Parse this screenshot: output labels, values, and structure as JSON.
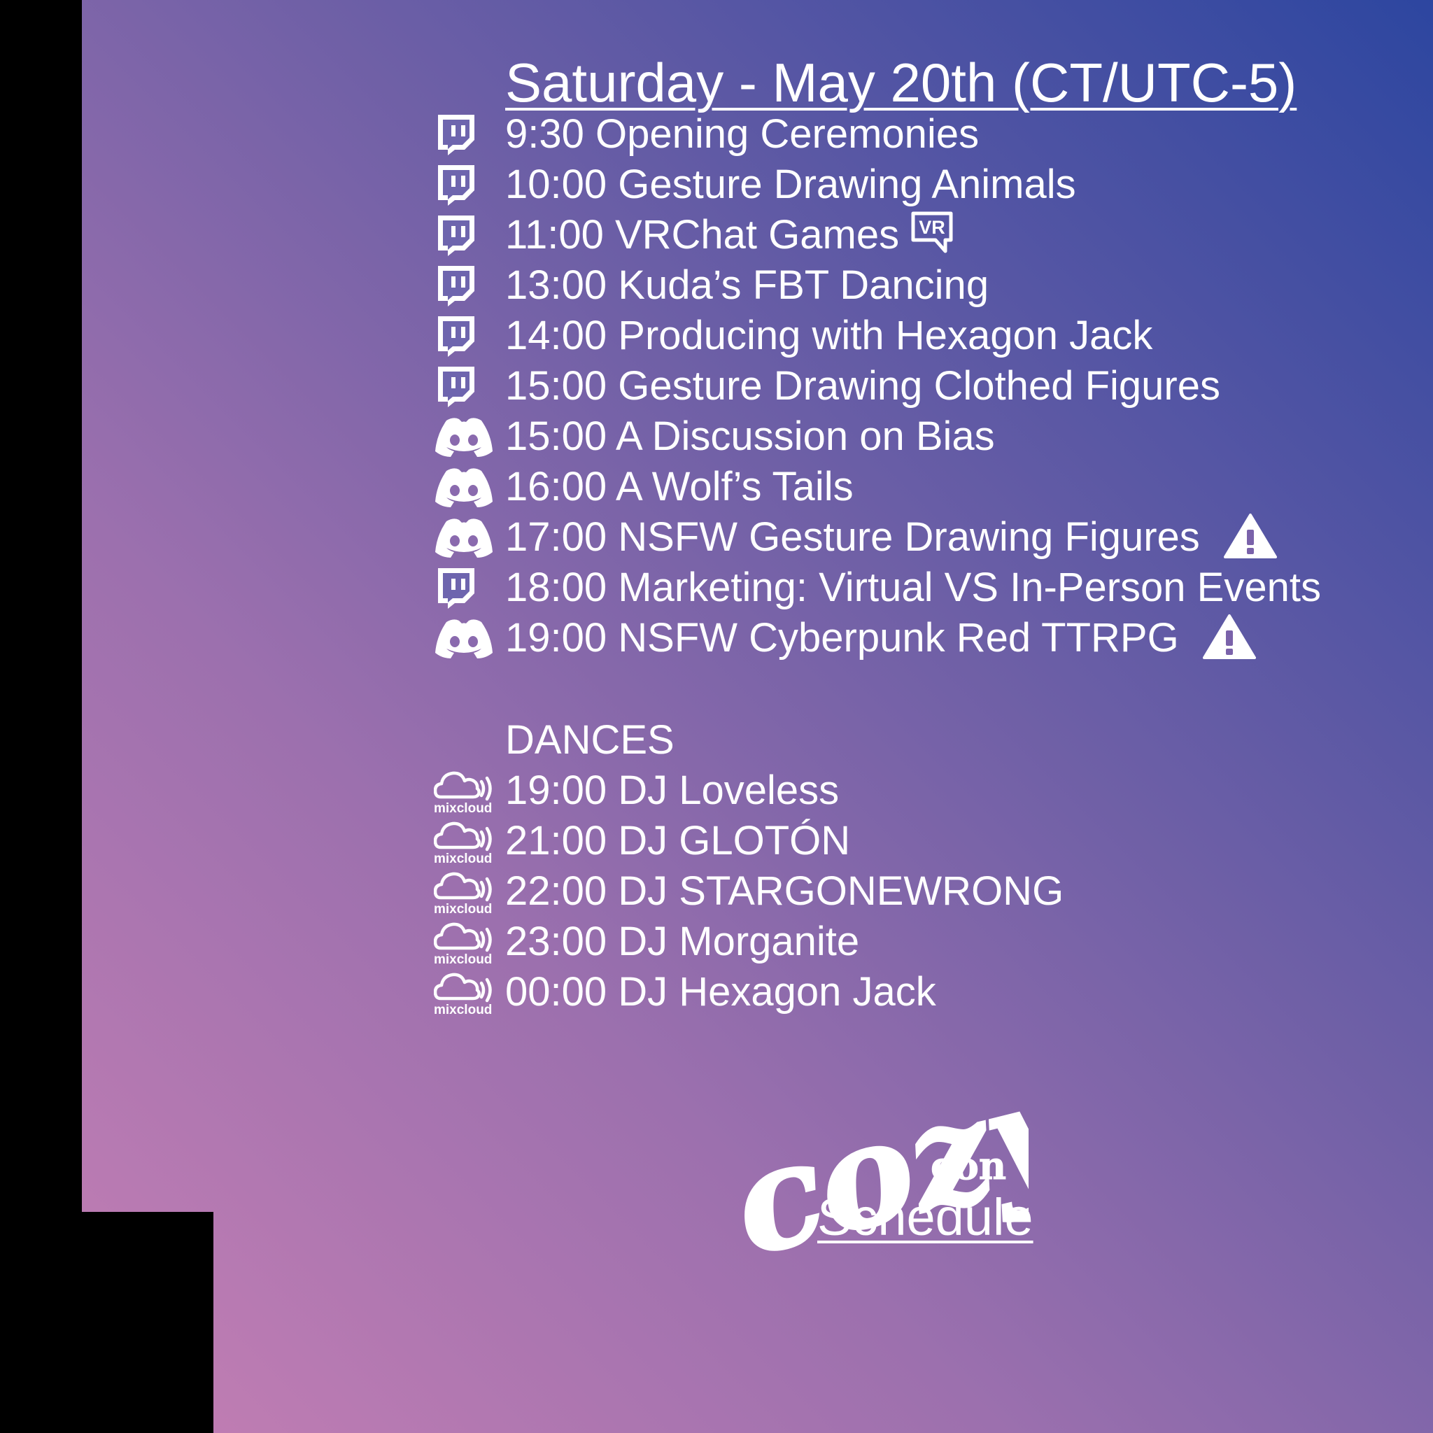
{
  "title": "Saturday - May 20th (CT/UTC-5)",
  "events": [
    {
      "platform": "twitch-icon",
      "label": "9:30 Opening Ceremonies"
    },
    {
      "platform": "twitch-icon",
      "label": "10:00 Gesture Drawing Animals"
    },
    {
      "platform": "twitch-icon",
      "label": "11:00 VRChat Games",
      "badge": "vr-icon",
      "badge_text": "VR"
    },
    {
      "platform": "twitch-icon",
      "label": "13:00 Kuda’s FBT Dancing"
    },
    {
      "platform": "twitch-icon",
      "label": "14:00 Producing with Hexagon Jack"
    },
    {
      "platform": "twitch-icon",
      "label": "15:00 Gesture Drawing Clothed Figures"
    },
    {
      "platform": "discord-icon",
      "label": "15:00 A Discussion on Bias"
    },
    {
      "platform": "discord-icon",
      "label": "16:00 A Wolf’s Tails"
    },
    {
      "platform": "discord-icon",
      "label": "17:00 NSFW Gesture Drawing Figures",
      "badge": "warning-icon"
    },
    {
      "platform": "twitch-icon",
      "label": "18:00 Marketing: Virtual VS In-Person Events"
    },
    {
      "platform": "discord-icon",
      "label": "19:00 NSFW Cyberpunk Red TTRPG",
      "badge": "warning-icon"
    }
  ],
  "dances_heading": "DANCES",
  "mixcloud_text": "mixcloud",
  "dances": [
    {
      "platform": "mixcloud-icon",
      "label": "19:00 DJ Loveless"
    },
    {
      "platform": "mixcloud-icon",
      "label": "21:00 DJ GLOTÓN"
    },
    {
      "platform": "mixcloud-icon",
      "label": "22:00 DJ STARGONEWRONG"
    },
    {
      "platform": "mixcloud-icon",
      "label": "23:00 DJ Morganite"
    },
    {
      "platform": "mixcloud-icon",
      "label": "00:00 DJ Hexagon Jack"
    }
  ],
  "logo": {
    "word": "cozy",
    "sub": "con"
  },
  "footer": "Schedule",
  "colors": {
    "gradient_pink": "#c880b4",
    "gradient_blue": "#2d46a0",
    "text": "#ffffff"
  }
}
